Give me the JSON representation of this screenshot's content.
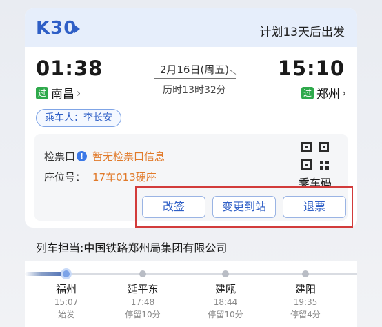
{
  "ticket": {
    "train_no": "K30",
    "depart_plan": "计划13天后出发",
    "departure": {
      "time": "01:38",
      "badge": "过",
      "station": "南昌",
      "chevron": "›"
    },
    "arrival": {
      "time": "15:10",
      "badge": "过",
      "station": "郑州",
      "chevron": "›"
    },
    "date": "2月16日(周五)",
    "duration": "历时13时32分",
    "passenger": "乘车人：李长安",
    "info": {
      "gate_label": "检票口",
      "gate_icon": "!",
      "gate_value": "暂无检票口信息",
      "seat_label": "座位号：",
      "seat_value": "17车013硬座"
    },
    "qr_label": "乘车码",
    "actions": {
      "change": "改签",
      "change_station": "变更到站",
      "refund": "退票"
    }
  },
  "operator": "列车担当:中国铁路郑州局集团有限公司",
  "route": {
    "stops": [
      {
        "name": "福州",
        "time": "15:07",
        "note": "始发"
      },
      {
        "name": "延平东",
        "time": "17:48",
        "note": "停留10分"
      },
      {
        "name": "建瓯",
        "time": "18:44",
        "note": "停留10分"
      },
      {
        "name": "建阳",
        "time": "19:35",
        "note": "停留4分"
      }
    ]
  },
  "colors": {
    "accent": "#2f5fc6",
    "badge_green": "#2ea94b",
    "warning_orange": "#e17a2a",
    "highlight_red": "#d23b3b"
  },
  "icons": {
    "train_chevron": "chevron-right-icon",
    "info": "info-icon",
    "qr": "qr-code-icon"
  }
}
